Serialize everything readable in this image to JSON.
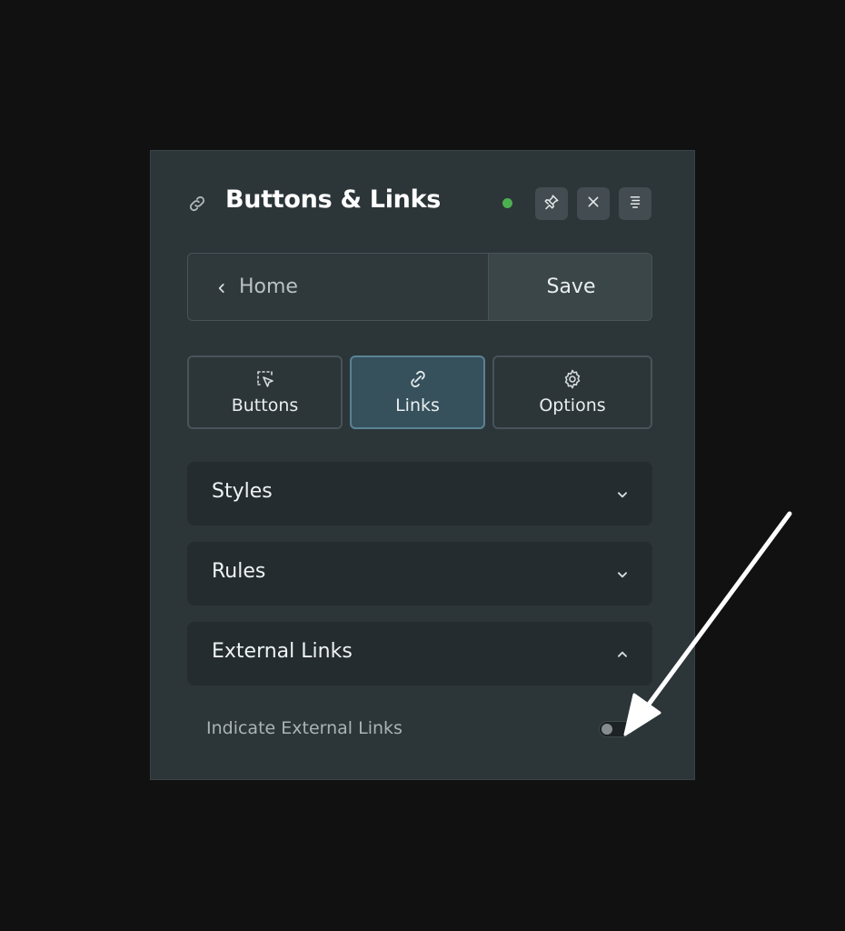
{
  "panel": {
    "title": "Buttons & Links",
    "title_icon": "link-icon",
    "status_color": "#4caf50",
    "header_buttons": [
      "pin-icon",
      "close-icon",
      "menu-icon"
    ]
  },
  "nav": {
    "home_label": "Home",
    "save_label": "Save"
  },
  "tabs": [
    {
      "label": "Buttons",
      "icon": "cursor-select-icon",
      "active": false
    },
    {
      "label": "Links",
      "icon": "chain-link-icon",
      "active": true
    },
    {
      "label": "Options",
      "icon": "gear-icon",
      "active": false
    }
  ],
  "sections": [
    {
      "label": "Styles",
      "expanded": false
    },
    {
      "label": "Rules",
      "expanded": false
    },
    {
      "label": "External Links",
      "expanded": true
    }
  ],
  "external_links": {
    "indicate_label": "Indicate External Links",
    "indicate_enabled": false
  },
  "colors": {
    "background": "#111112",
    "panel": "#2c3538",
    "active_tab": "#36505c",
    "active_tab_border": "#5a8396"
  }
}
